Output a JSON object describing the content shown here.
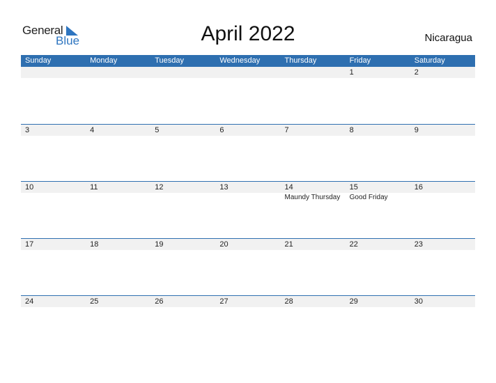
{
  "logo": {
    "word1": "General",
    "word2": "Blue",
    "accent": "#2e75c0"
  },
  "title": "April 2022",
  "country": "Nicaragua",
  "colors": {
    "header_bg": "#2e6fb0",
    "row_band": "#f1f1f1"
  },
  "weekdays": [
    "Sunday",
    "Monday",
    "Tuesday",
    "Wednesday",
    "Thursday",
    "Friday",
    "Saturday"
  ],
  "weeks": [
    [
      {
        "d": ""
      },
      {
        "d": ""
      },
      {
        "d": ""
      },
      {
        "d": ""
      },
      {
        "d": ""
      },
      {
        "d": "1"
      },
      {
        "d": "2"
      }
    ],
    [
      {
        "d": "3"
      },
      {
        "d": "4"
      },
      {
        "d": "5"
      },
      {
        "d": "6"
      },
      {
        "d": "7"
      },
      {
        "d": "8"
      },
      {
        "d": "9"
      }
    ],
    [
      {
        "d": "10"
      },
      {
        "d": "11"
      },
      {
        "d": "12"
      },
      {
        "d": "13"
      },
      {
        "d": "14",
        "e": "Maundy Thursday"
      },
      {
        "d": "15",
        "e": "Good Friday"
      },
      {
        "d": "16"
      }
    ],
    [
      {
        "d": "17"
      },
      {
        "d": "18"
      },
      {
        "d": "19"
      },
      {
        "d": "20"
      },
      {
        "d": "21"
      },
      {
        "d": "22"
      },
      {
        "d": "23"
      }
    ],
    [
      {
        "d": "24"
      },
      {
        "d": "25"
      },
      {
        "d": "26"
      },
      {
        "d": "27"
      },
      {
        "d": "28"
      },
      {
        "d": "29"
      },
      {
        "d": "30"
      }
    ]
  ]
}
